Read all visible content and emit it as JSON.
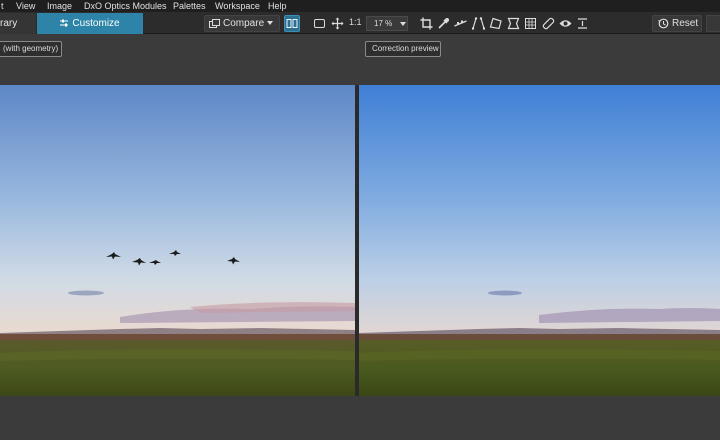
{
  "menu": {
    "items": [
      "t",
      "View",
      "Image",
      "DxO Optics Modules",
      "Palettes",
      "Workspace",
      "Help"
    ]
  },
  "toolbar": {
    "library_tab": "rary",
    "customize_tab": "Customize",
    "compare_label": "Compare",
    "actual_size_label": "1:1",
    "zoom_value": "17 %",
    "reset_label": "Reset"
  },
  "preview": {
    "left_caption": "(with geometry)",
    "right_caption": "Correction preview"
  },
  "colors": {
    "accent": "#2e84a8",
    "sky_top_left": "#5a86c4",
    "sky_top_right": "#3f7fd6",
    "grass": "#4d5a22"
  },
  "icons": [
    "customize-sliders-icon",
    "compare-icon",
    "side-by-side-icon",
    "fit-screen-icon",
    "move-icon",
    "crop-icon",
    "eyedropper-icon",
    "horizon-icon",
    "perspective-icon",
    "perspective-8pt-icon",
    "volume-deformation-icon",
    "grid-icon",
    "repair-icon",
    "eye-icon",
    "ruler-icon",
    "reset-icon"
  ]
}
